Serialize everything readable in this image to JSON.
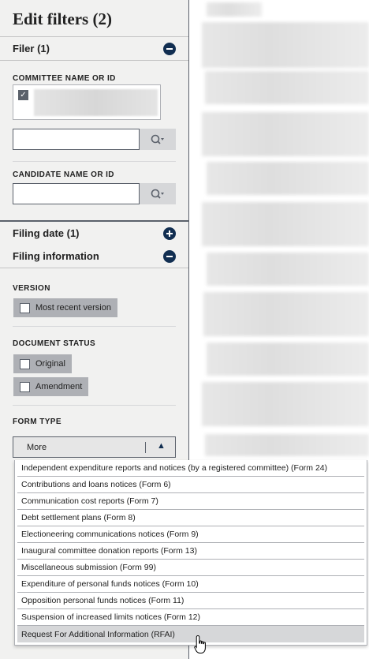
{
  "panel": {
    "title": "Edit filters (2)"
  },
  "filer": {
    "header": "Filer (1)",
    "committee_label": "COMMITTEE NAME OR ID",
    "candidate_label": "CANDIDATE NAME OR ID",
    "committee_input_value": "",
    "candidate_input_value": "",
    "search_icon": "search-icon"
  },
  "filing_date": {
    "header": "Filing date (1)"
  },
  "filing_info": {
    "header": "Filing information",
    "version_label": "VERSION",
    "most_recent_label": "Most recent version",
    "status_label": "DOCUMENT STATUS",
    "original_label": "Original",
    "amendment_label": "Amendment",
    "form_type_label": "FORM TYPE",
    "select_value": "More"
  },
  "form_type_options": [
    "Independent expenditure reports and notices (by a registered committee) (Form 24)",
    "Contributions and loans notices (Form 6)",
    "Communication cost reports (Form 7)",
    "Debt settlement plans (Form 8)",
    "Electioneering communications notices (Form 9)",
    "Inaugural committee donation reports (Form 13)",
    "Miscellaneous submission (Form 99)",
    "Expenditure of personal funds notices (Form 10)",
    "Opposition personal funds notices (Form 11)",
    "Suspension of increased limits notices (Form 12)",
    "Request For Additional Information (RFAI)"
  ],
  "colors": {
    "sidebar_bg": "#f1f1f0",
    "accent_navy": "#112e51",
    "option_hover": "#d6d7d9"
  }
}
